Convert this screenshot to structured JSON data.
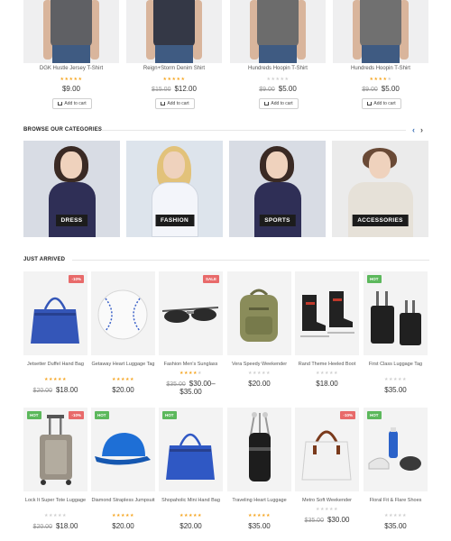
{
  "top_products": [
    {
      "name": "DGK Hustle Jersey T-Shirt",
      "rating": 5,
      "old_price": "",
      "price": "$9.00",
      "button": "Add to cart",
      "shirt_color": "#5f6064"
    },
    {
      "name": "Reign+Storm Denim Shirt",
      "rating": 5,
      "old_price": "$15.00",
      "price": "$12.00",
      "button": "Add to cart",
      "shirt_color": "#343846"
    },
    {
      "name": "Hundreds Hoopin T-Shirt",
      "rating": 0,
      "old_price": "$9.00",
      "price": "$5.00",
      "button": "Add to cart",
      "shirt_color": "#6c6c6c"
    },
    {
      "name": "Hundreds Hoopin T-Shirt",
      "rating": 4,
      "old_price": "$9.00",
      "price": "$5.00",
      "button": "Add to cart",
      "shirt_color": "#707070"
    }
  ],
  "categories_section": {
    "title": "BROWSE OUR CATEGORIES",
    "prev_icon": "chevron-left-icon",
    "next_icon": "chevron-right-icon",
    "prev_color": "#3a6fb5"
  },
  "categories": [
    {
      "label": "DRESS",
      "bg": "#d8dce4",
      "hair": "#3a2a24",
      "top": "#2f2f56"
    },
    {
      "label": "FASHION",
      "bg": "#dde4ec",
      "hair": "#e2c27a",
      "top": "#f3f5fa"
    },
    {
      "label": "SPORTS",
      "bg": "#d8dce4",
      "hair": "#3a2a24",
      "top": "#2f2f56"
    },
    {
      "label": "ACCESSORIES",
      "bg": "#ebebeb",
      "hair": "#6a4a36",
      "top": "#e6e1d8"
    }
  ],
  "just_arrived": {
    "title": "JUST ARRIVED",
    "products": [
      {
        "name": "Jetsetter Duffel Hand Bag",
        "badge": "-10%",
        "badge_type": "sale",
        "rating": 5,
        "old_price": "$20.00",
        "price": "$18.00",
        "icon": "handbag-icon",
        "color": "#3456b8"
      },
      {
        "name": "Getaway Heart Luggage Tag",
        "badge": "",
        "badge_type": "",
        "rating": 5,
        "old_price": "",
        "price": "$20.00",
        "icon": "baseball-icon",
        "color": "#ffffff"
      },
      {
        "name": "Fashion Men's Sunglass",
        "badge": "SALE",
        "badge_type": "sale",
        "rating": 4,
        "old_price": "$35.00",
        "price": "$30.00–$35.00",
        "icon": "sunglasses-icon",
        "color": "#2b2b2b"
      },
      {
        "name": "Vera Speedy Weekender",
        "badge": "",
        "badge_type": "",
        "rating": 0,
        "old_price": "",
        "price": "$20.00",
        "icon": "backpack-icon",
        "color": "#8a8c5a"
      },
      {
        "name": "Rand Theme Heeled Boot",
        "badge": "",
        "badge_type": "",
        "rating": 0,
        "old_price": "",
        "price": "$18.00",
        "icon": "skate-boot-icon",
        "color": "#222222"
      },
      {
        "name": "First Class Luggage Tag",
        "badge": "HOT",
        "badge_type": "hot",
        "rating": 0,
        "old_price": "",
        "price": "$35.00",
        "icon": "suitcase-icon",
        "color": "#202020"
      },
      {
        "name": "Lock It Super Tote Luggage",
        "badge": "-10%",
        "badge_type": "sale",
        "badge2": "HOT",
        "rating": 0,
        "old_price": "$20.00",
        "price": "$18.00",
        "icon": "trolley-icon",
        "color": "#9a9286"
      },
      {
        "name": "Diamond Strapless Jumpsuit",
        "badge": "HOT",
        "badge_type": "hot",
        "rating": 5,
        "old_price": "",
        "price": "$20.00",
        "icon": "cap-icon",
        "color": "#1e6fd6"
      },
      {
        "name": "Shopaholic Mini Hand Bag",
        "badge": "HOT",
        "badge_type": "hot",
        "rating": 5,
        "old_price": "",
        "price": "$20.00",
        "icon": "handbag-icon",
        "color": "#2f58c4"
      },
      {
        "name": "Traveling Heart Luggage",
        "badge": "",
        "badge_type": "",
        "rating": 5,
        "old_price": "",
        "price": "$35.00",
        "icon": "golf-bag-icon",
        "color": "#1d1d1d"
      },
      {
        "name": "Metro Soft Weekender",
        "badge": "-10%",
        "badge_type": "sale",
        "rating": 0,
        "old_price": "$35.00",
        "price": "$30.00",
        "icon": "tote-bag-icon",
        "color": "#f2f2f2"
      },
      {
        "name": "Floral Fit & Flare Shoes",
        "badge": "HOT",
        "badge_type": "hot",
        "rating": 0,
        "old_price": "",
        "price": "$35.00",
        "icon": "sport-bottle-icon",
        "color": "#2a62c9"
      }
    ]
  },
  "colors": {
    "star": "#f5a623",
    "sale_badge": "#e86a6a",
    "hot_badge": "#5cb85c"
  }
}
